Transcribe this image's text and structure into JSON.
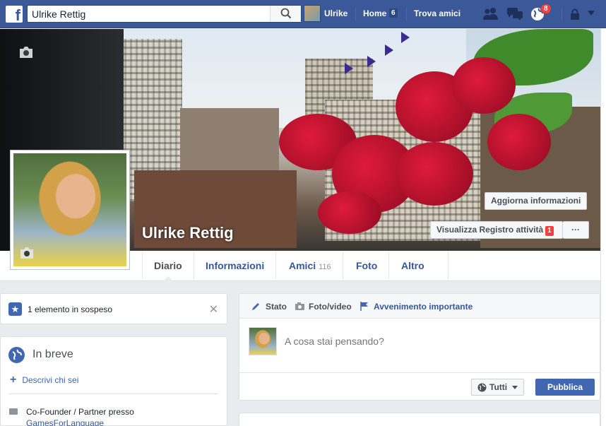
{
  "topbar": {
    "search_value": "Ulrike Rettig",
    "user_name": "Ulrike",
    "home_label": "Home",
    "home_count": "6",
    "find_friends": "Trova amici",
    "notifications_count": "8"
  },
  "cover": {
    "profile_name": "Ulrike Rettig",
    "update_info_label": "Aggiorna informazioni",
    "activity_log_label": "Visualizza Registro attività",
    "activity_log_count": "1",
    "more_label": "···"
  },
  "nav": {
    "tabs": [
      {
        "label": "Diario"
      },
      {
        "label": "Informazioni"
      },
      {
        "label": "Amici",
        "count": "116"
      },
      {
        "label": "Foto"
      },
      {
        "label": "Altro"
      }
    ]
  },
  "pending": {
    "text": "1 elemento in sospeso"
  },
  "intro": {
    "title": "In breve",
    "add_label": "Descrivi chi sei",
    "work_text": "Co-Founder / Partner presso",
    "work_link": "GamesForLanguage"
  },
  "composer": {
    "tabs": [
      "Stato",
      "Foto/video",
      "Avvenimento importante"
    ],
    "placeholder": "A cosa stai pensando?",
    "audience_label": "Tutti",
    "publish_label": "Pubblica"
  },
  "colors": {
    "brand": "#3b5998",
    "accent": "#4267b2",
    "badge": "#fa3e3e"
  }
}
